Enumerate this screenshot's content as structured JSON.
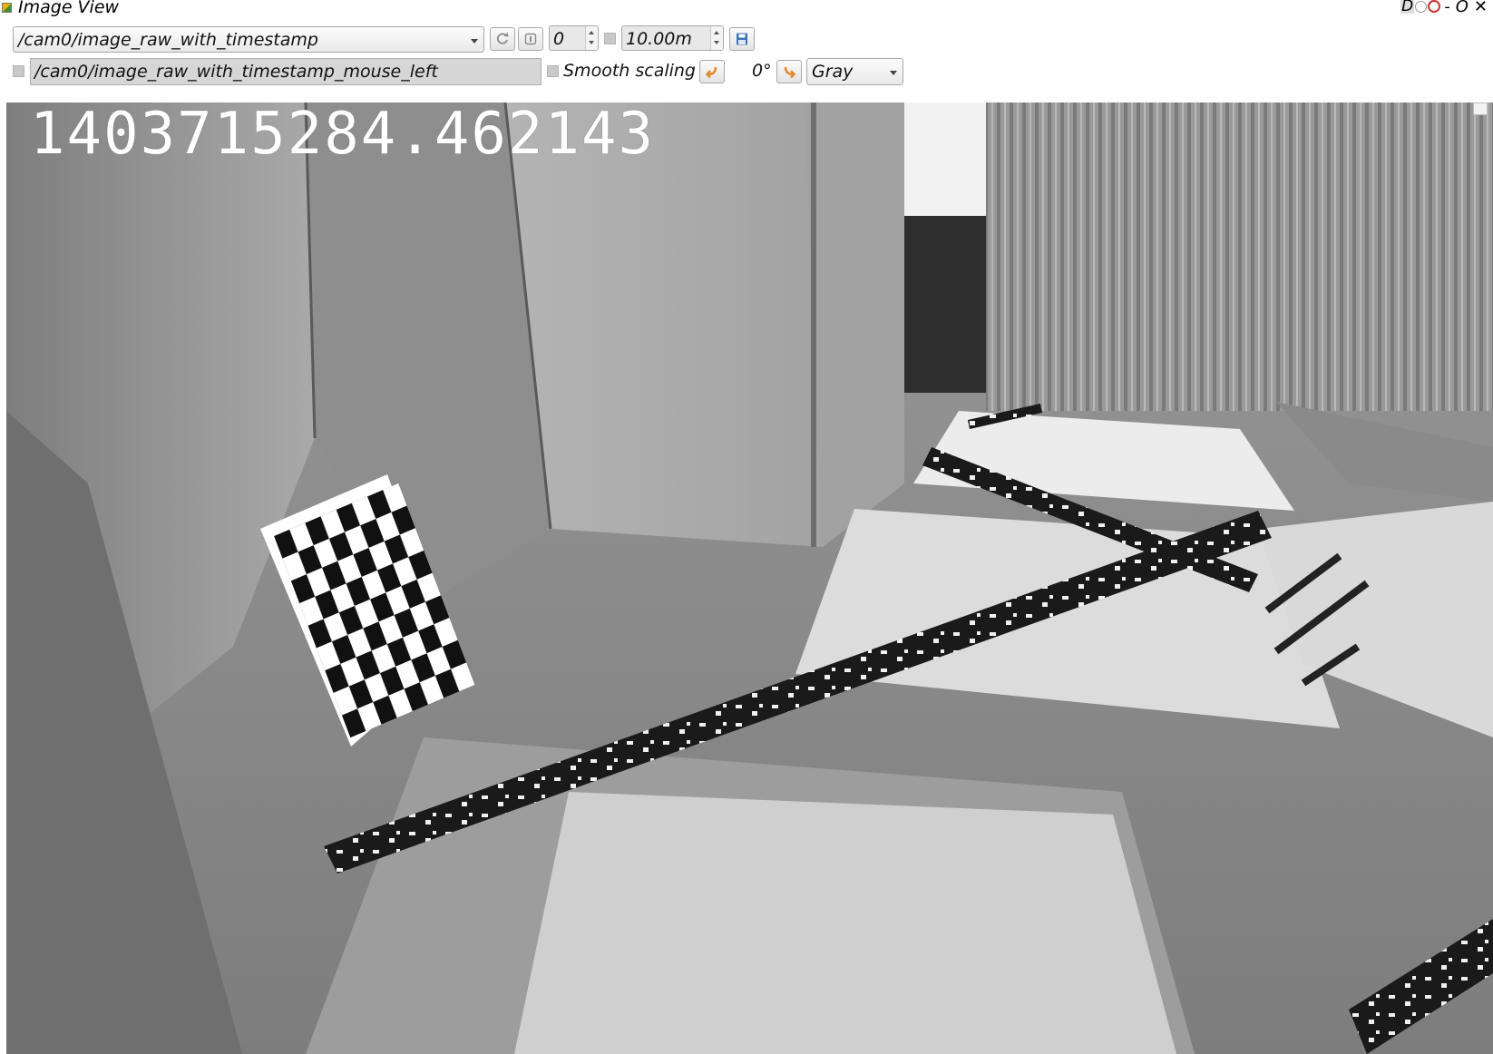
{
  "window": {
    "title": "Image View",
    "corner_letter": "D",
    "minimize_label": "-",
    "restore_label": "O"
  },
  "toolbar": {
    "topic_select": {
      "value": "/cam0/image_raw_with_timestamp"
    },
    "refresh_icon": "refresh-icon",
    "pause_icon": "pause-icon",
    "max_range_value": "0",
    "time_value": "10.00m",
    "save_icon": "save-icon",
    "mouse_topic": {
      "value": "/cam0/image_raw_with_timestamp_mouse_left"
    },
    "smooth_scaling_label": "Smooth scaling",
    "rotate_left_icon": "rotate-left-icon",
    "rotation_label": "0°",
    "rotate_right_icon": "rotate-right-icon",
    "colormap_select": {
      "value": "Gray"
    }
  },
  "image": {
    "timestamp_overlay": "1403715284.462143"
  },
  "colors": {
    "accent_orange": "#e8872a",
    "checkbox_gray": "#c8c8c8"
  }
}
